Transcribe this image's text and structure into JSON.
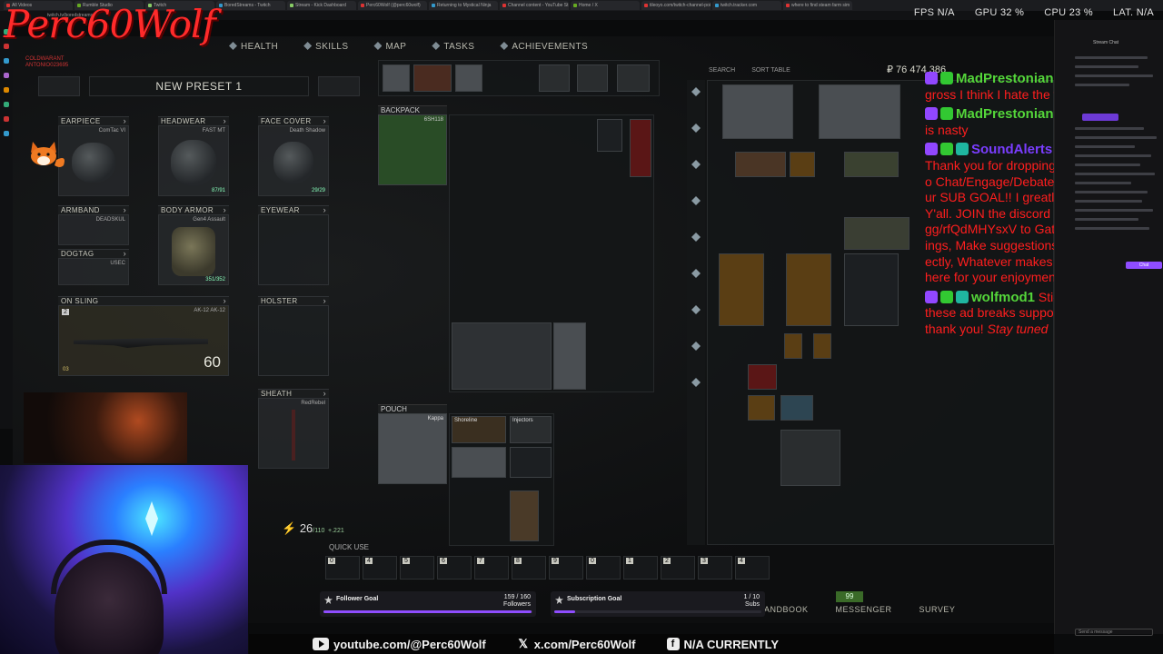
{
  "browser": {
    "tabs": [
      "All Videos",
      "Rumble Studio",
      "Twitch",
      "BoredStreams - Twitch",
      "Stream - Kick Dashboard",
      "Perc60Wolf (@perc60wolf)",
      "Returning to Mystical Ninja",
      "Channel content - YouTube St",
      "Home / X",
      "tileoyo.com/twitch-channel-poi",
      "twitch.tracker.com",
      "where to find steam farm sim"
    ],
    "url": "twitch.tv/boredstreams"
  },
  "stats": {
    "fps_label": "FPS",
    "fps": "N/A",
    "gpu_label": "GPU",
    "gpu": "32 %",
    "cpu_label": "CPU",
    "cpu": "23 %",
    "lat_label": "LAT.",
    "lat": "N/A"
  },
  "logo": {
    "text": "Perc60Wolf",
    "sub1": "COLDWARANT",
    "sub2": "ANTONIO023695"
  },
  "nav": {
    "items": [
      {
        "label": "HEALTH",
        "icon": "health-icon"
      },
      {
        "label": "SKILLS",
        "icon": "skills-icon"
      },
      {
        "label": "MAP",
        "icon": "map-pin-icon"
      },
      {
        "label": "TASKS",
        "icon": "tasks-icon"
      },
      {
        "label": "ACHIEVEMENTS",
        "icon": "achievements-icon"
      }
    ]
  },
  "preset": {
    "title": "NEW PRESET 1"
  },
  "slots": {
    "earpiece": {
      "label": "EARPIECE",
      "name": "ComTac VI"
    },
    "headwear": {
      "label": "HEADWEAR",
      "name": "FAST MT",
      "durability": "87/91"
    },
    "face_cover": {
      "label": "FACE COVER",
      "name": "Death Shadow",
      "durability": "29/29"
    },
    "armband": {
      "label": "ARMBAND",
      "name": "DEADSKUL"
    },
    "body_armor": {
      "label": "BODY ARMOR",
      "name": "Gen4 Assault",
      "durability": "351/352"
    },
    "eyewear": {
      "label": "EYEWEAR"
    },
    "dogtag": {
      "label": "DOGTAG",
      "name": "USEC"
    },
    "on_sling": {
      "label": "ON SLING",
      "name": "AK-12 AK-12",
      "slot_number": "2",
      "ammo": "60",
      "tag": "03"
    },
    "holster": {
      "label": "HOLSTER"
    },
    "sheath": {
      "label": "SHEATH",
      "name": "RedRebel"
    },
    "backpack": {
      "label": "BACKPACK",
      "name": "6SH118"
    },
    "pouch": {
      "label": "POUCH",
      "name": "Kappa"
    }
  },
  "containers": {
    "shoreline": "Shoreline",
    "injectors": "Injectors"
  },
  "quick_use": {
    "label": "QUICK USE",
    "slots": [
      "0",
      "4",
      "5",
      "6",
      "7",
      "8",
      "9",
      "0",
      "1",
      "2",
      "3",
      "4"
    ]
  },
  "energy": {
    "value": "26",
    "max": "/110",
    "rate": "+.221"
  },
  "stash": {
    "money": "₽ 76 474 386",
    "search": "SEARCH",
    "sort": "SORT TABLE"
  },
  "bottom_tabs": [
    "HANDBOOK",
    "MESSENGER",
    "SURVEY"
  ],
  "level_badge": "99",
  "chat": [
    {
      "user": "MadPrestonian",
      "style": "green",
      "text": "Oohlet it was gross I think I hate the foods lol"
    },
    {
      "user": "MadPrestonian",
      "style": "green",
      "text": "is nasty"
    },
    {
      "user": "SoundAlerts",
      "style": "purple",
      "text": "Thank you for dropping in! Feel free to Chat/Engage/Debate! Help us hit our SUB GOAL!! I greatly appreciate Y'all. JOIN the discord https://discord.gg/rfQdMHYsxV to Gather, Discuss things, Make suggestions, Yell at me directly, Whatever makes you happy. I'm here for your enjoyment"
    },
    {
      "user": "wolfmod1",
      "style": "green",
      "text": "Sticking through these ad breaks supports the stream, thank you!",
      "suffix": "Stay tuned"
    }
  ],
  "goals": {
    "follower": {
      "label": "Follower Goal",
      "value": "159 / 160",
      "unit": "Followers",
      "progress": 0.99375
    },
    "subscription": {
      "label": "Subscription Goal",
      "value": "1 / 10",
      "unit": "Subs",
      "progress": 0.1
    }
  },
  "socials": {
    "youtube": "youtube.com/@Perc60Wolf",
    "x": "x.com/Perc60Wolf",
    "facebook": "N/A CURRENTLY"
  },
  "twitch_panel": {
    "stream_chat": "Stream Chat",
    "chat_button": "Chat",
    "send_placeholder": "Send a message"
  }
}
